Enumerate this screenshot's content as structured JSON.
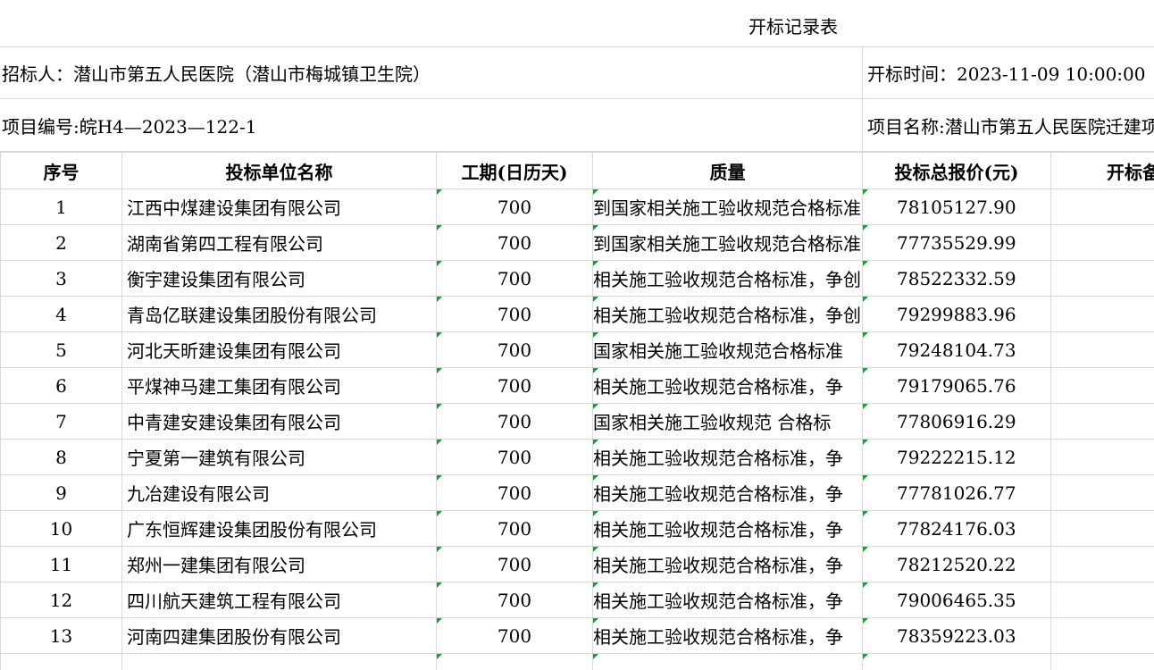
{
  "title": "开标记录表",
  "tenderer": "招标人：潜山市第五人民医院（潜山市梅城镇卫生院）",
  "open_time": "开标时间：2023-11-09 10:00:00",
  "project_no": "项目编号:皖H4—2023—122-1",
  "project_name": "项目名称:潜山市第五人民医院迁建项目",
  "columns": [
    "序号",
    "投标单位名称",
    "工期(日历天)",
    "质量",
    "投标总报价(元)",
    "开标备注"
  ],
  "rows": [
    {
      "idx": "1",
      "name": "江西中煤建设集团有限公司",
      "period": "700",
      "quality": "到国家相关施工验收规范合格标准",
      "price": "78105127.90"
    },
    {
      "idx": "2",
      "name": "湖南省第四工程有限公司",
      "period": "700",
      "quality": "到国家相关施工验收规范合格标准",
      "price": "77735529.99"
    },
    {
      "idx": "3",
      "name": "衡宇建设集团有限公司",
      "period": "700",
      "quality": "相关施工验收规范合格标准，争创",
      "price": "78522332.59"
    },
    {
      "idx": "4",
      "name": "青岛亿联建设集团股份有限公司",
      "period": "700",
      "quality": "相关施工验收规范合格标准，争创",
      "price": "79299883.96"
    },
    {
      "idx": "5",
      "name": "河北天昕建设集团有限公司",
      "period": "700",
      "quality": "国家相关施工验收规范合格标准",
      "price": "79248104.73"
    },
    {
      "idx": "6",
      "name": "平煤神马建工集团有限公司",
      "period": "700",
      "quality": "相关施工验收规范合格标准，争",
      "price": "79179065.76"
    },
    {
      "idx": "7",
      "name": "中青建安建设集团有限公司",
      "period": "700",
      "quality": " 国家相关施工验收规范 合格标",
      "price": "77806916.29"
    },
    {
      "idx": "8",
      "name": "宁夏第一建筑有限公司",
      "period": "700",
      "quality": "相关施工验收规范合格标准，争",
      "price": "79222215.12"
    },
    {
      "idx": "9",
      "name": "九冶建设有限公司",
      "period": "700",
      "quality": "相关施工验收规范合格标准，争",
      "price": "77781026.77"
    },
    {
      "idx": "10",
      "name": "广东恒辉建设集团股份有限公司",
      "period": "700",
      "quality": "相关施工验收规范合格标准，争",
      "price": "77824176.03"
    },
    {
      "idx": "11",
      "name": "郑州一建集团有限公司",
      "period": "700",
      "quality": "相关施工验收规范合格标准，争",
      "price": "78212520.22"
    },
    {
      "idx": "12",
      "name": "四川航天建筑工程有限公司",
      "period": "700",
      "quality": "相关施工验收规范合格标准，争",
      "price": "79006465.35"
    },
    {
      "idx": "13",
      "name": "河南四建集团股份有限公司",
      "period": "700",
      "quality": "相关施工验收规范合格标准，争",
      "price": "78359223.03"
    },
    {
      "idx": "",
      "name": "",
      "period": "",
      "quality": "",
      "price": ""
    }
  ],
  "colors": {
    "grid_line": "#d9d9d9",
    "comment_marker": "#1a9c3c"
  }
}
